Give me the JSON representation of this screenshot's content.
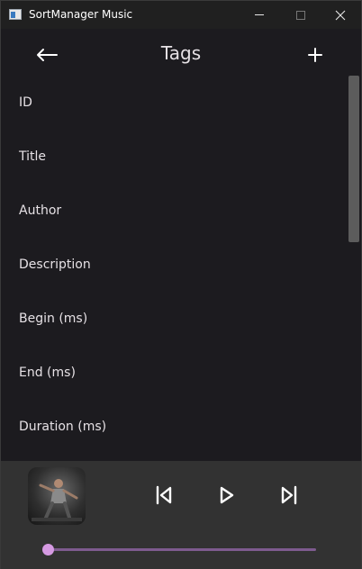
{
  "window": {
    "title": "SortManager Music"
  },
  "header": {
    "title": "Tags",
    "back_icon": "arrow-left-icon",
    "add_icon": "plus-icon"
  },
  "tags": [
    {
      "label": "ID"
    },
    {
      "label": "Title"
    },
    {
      "label": "Author"
    },
    {
      "label": "Description"
    },
    {
      "label": "Begin (ms)"
    },
    {
      "label": "End (ms)"
    },
    {
      "label": "Duration (ms)"
    }
  ],
  "player": {
    "prev_icon": "skip-previous-icon",
    "play_icon": "play-icon",
    "next_icon": "skip-next-icon",
    "progress": 0
  },
  "colors": {
    "background": "#1c1b1f",
    "player_background": "#323232",
    "accent": "#d59ae2",
    "slider_track": "#7e5b8f"
  }
}
